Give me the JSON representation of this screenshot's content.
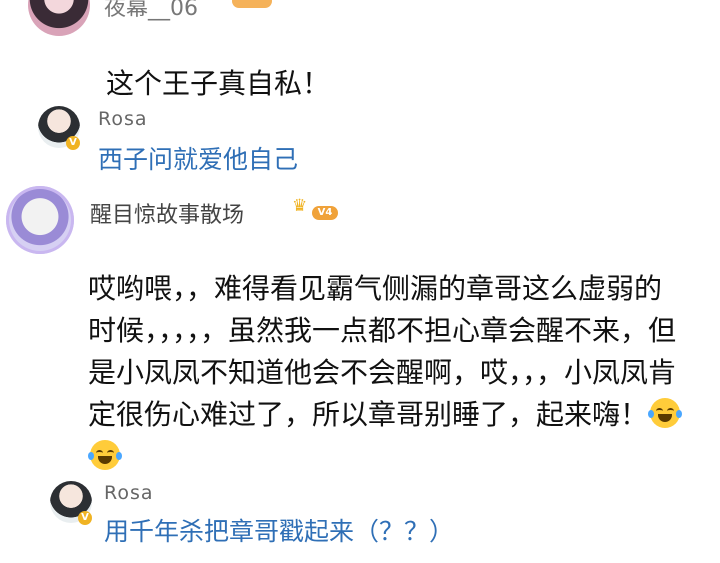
{
  "comments": [
    {
      "username": "夜幕__06",
      "avatar": "avatar-girl",
      "level": "",
      "text": "这个王子真自私！"
    },
    {
      "username": "醒目惊故事散场",
      "avatar": "avatar-anime-frame",
      "level": "V4",
      "text": "哎哟喂，，难得看见霸气侧漏的章哥这么虚弱的时候，，，，，虽然我一点都不担心章会醒不来，但是小凤凤不知道他会不会醒啊，哎，，，小凤凤肯定很伤心难过了，所以章哥别睡了，起来嗨！"
    }
  ],
  "replies": [
    {
      "username": "Rosa",
      "verified": "V",
      "text": "西子问就爱他自己"
    },
    {
      "username": "Rosa",
      "verified": "V",
      "text": "用千年杀把章哥戳起来（？？）"
    }
  ],
  "colors": {
    "reply_text": "#2f6fb6",
    "badge_gold": "#f0b323"
  },
  "icons": [
    "verified-badge-icon",
    "crown-icon",
    "laugh-cry-emoji-icon"
  ]
}
